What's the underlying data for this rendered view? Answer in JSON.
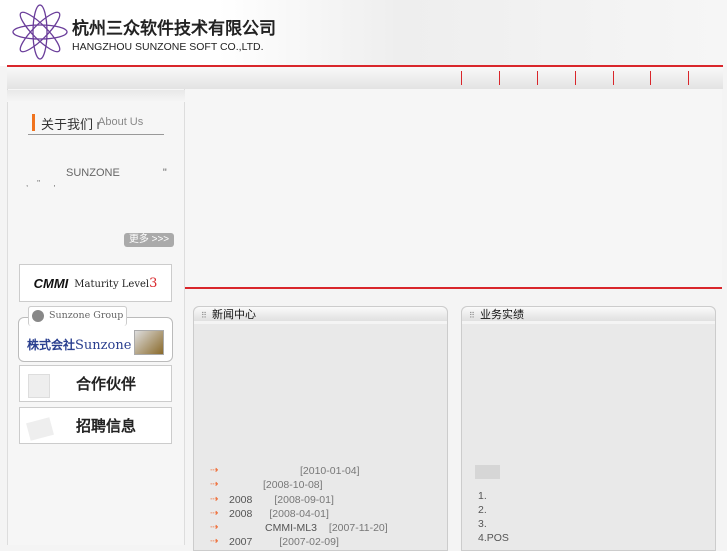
{
  "header": {
    "company_cn": "杭州三众软件技术有限公司",
    "company_en": "HANGZHOU SUNZONE SOFT CO.,LTD."
  },
  "nav": {
    "items": [
      "",
      "",
      "",
      "",
      "",
      "",
      ""
    ]
  },
  "about": {
    "title_cn": "关于我们",
    "title_en": "About Us",
    "separator": "I",
    "body_line1": "SUNZONE",
    "body_line1_tail": "\"",
    "body_line2": ",    \"      ,",
    "more_label": "更多 >>>"
  },
  "side_links": {
    "cmmi": {
      "logo": "CMMI",
      "label": "Maturity Level",
      "level": "3"
    },
    "group": {
      "tab": "Sunzone Group",
      "name_cn": "株式会社",
      "name_en": "Sunzone"
    },
    "partners": "合作伙伴",
    "jobs": "招聘信息"
  },
  "news": {
    "title": "新闻中心",
    "items": [
      {
        "title": "",
        "date": "[2010-01-04]"
      },
      {
        "title": "",
        "date": "[2008-10-08]"
      },
      {
        "title": "2008",
        "date": "[2008-09-01]"
      },
      {
        "title": "2008",
        "date": "[2008-04-01]"
      },
      {
        "title": "CMMI-ML3",
        "date": "[2007-11-20]"
      },
      {
        "title": "2007",
        "date": "[2007-02-09]"
      }
    ]
  },
  "business": {
    "title": "业务实绩",
    "items": [
      "1.",
      "2.",
      "3.",
      "4.POS"
    ]
  },
  "colors": {
    "accent_red": "#d9262b",
    "accent_orange": "#f0731e"
  }
}
